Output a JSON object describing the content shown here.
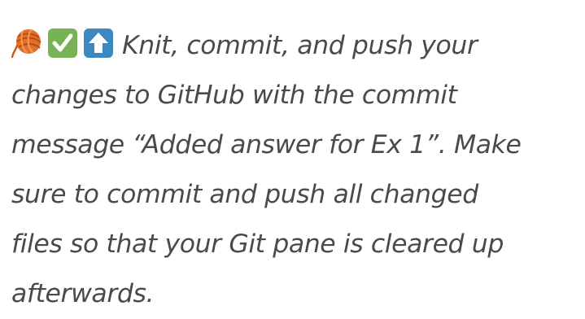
{
  "icons": [
    {
      "name": "yarn-ball-icon",
      "color": "#e0702a"
    },
    {
      "name": "check-mark-button-icon",
      "color": "#77b255"
    },
    {
      "name": "up-arrow-button-icon",
      "color": "#3b88c3"
    }
  ],
  "exercise_text": {
    "line_1": "Knit, commit, and push your",
    "line_2": "changes to GitHub with the commit",
    "line_3": "message “Added answer for Ex 1”. Make",
    "line_4": "sure to commit and push all changed",
    "line_5": "files so that your Git pane is cleared up",
    "line_6": "afterwards."
  }
}
